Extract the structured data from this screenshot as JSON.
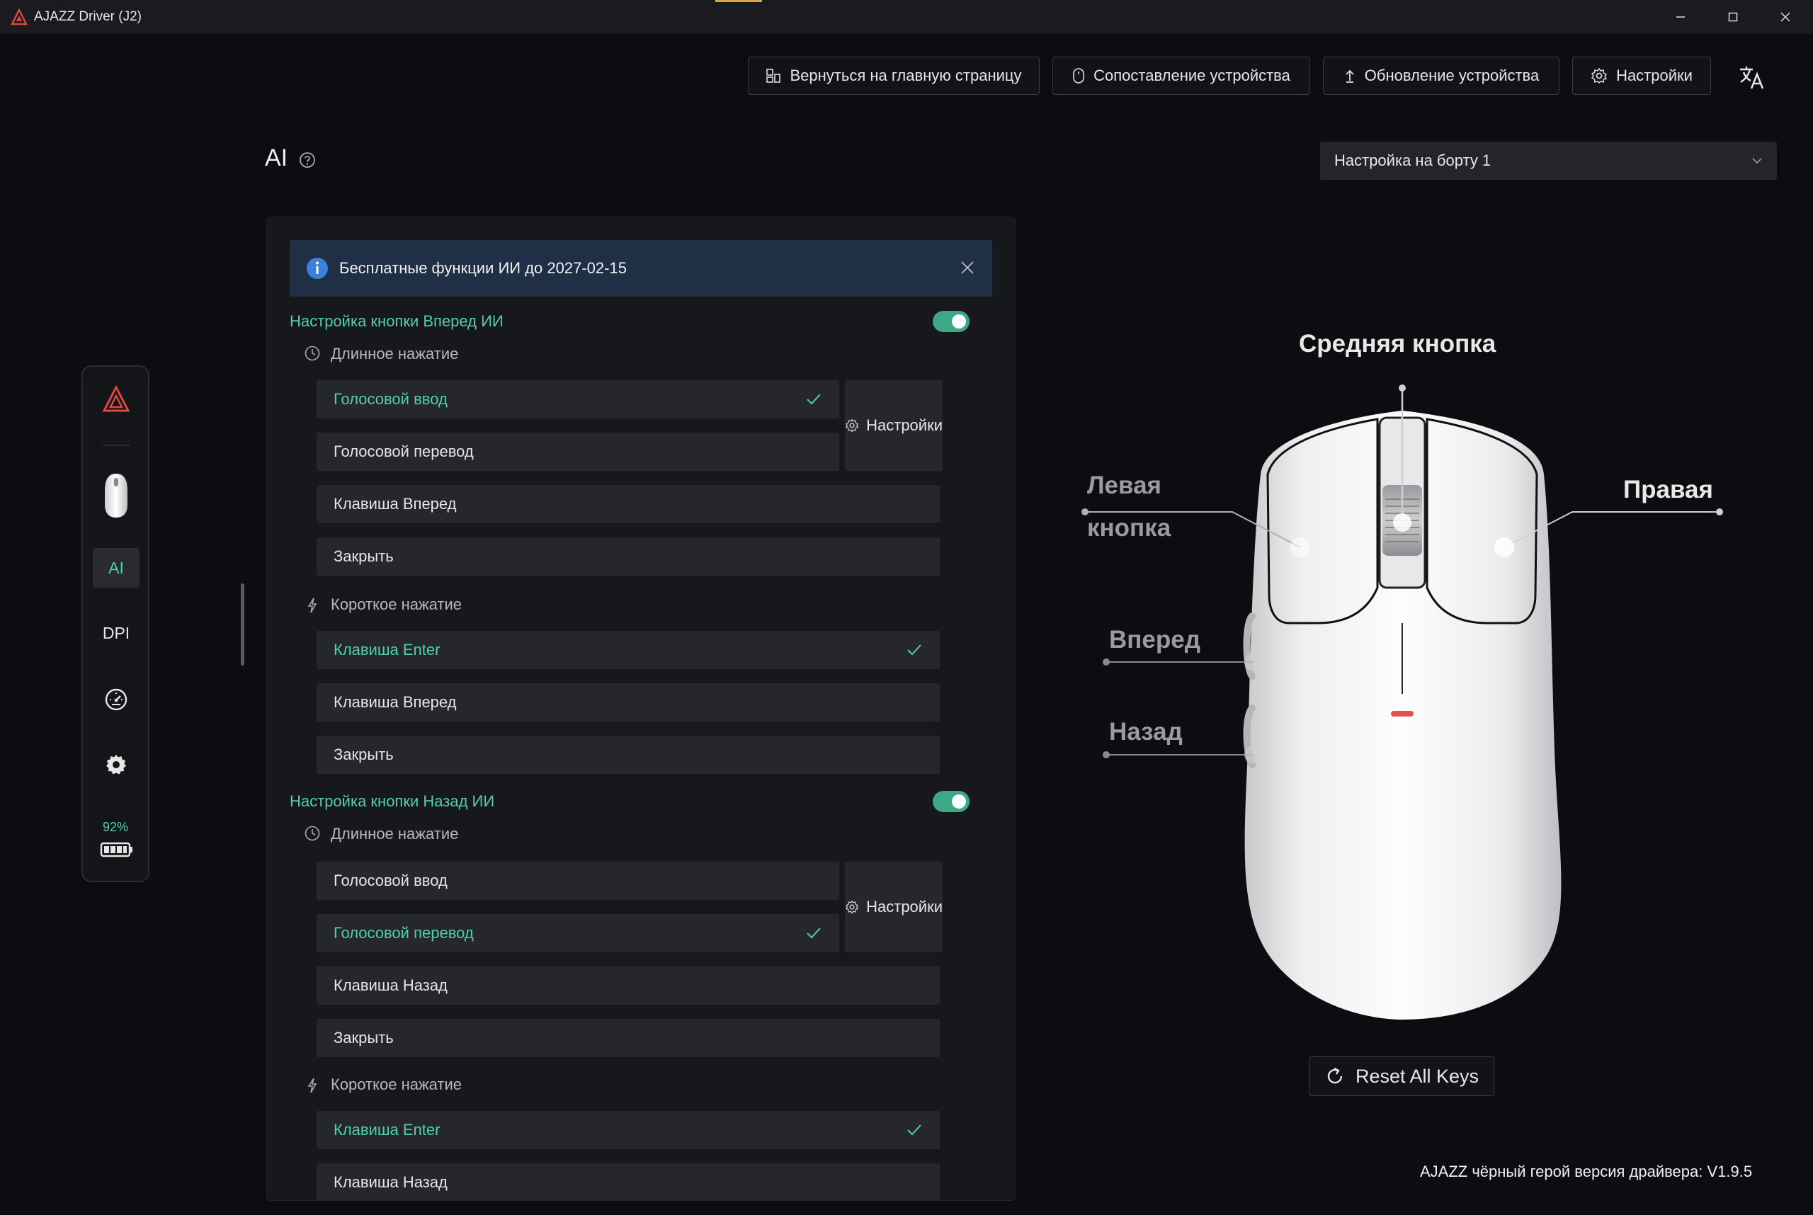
{
  "window": {
    "title": "AJAZZ Driver (J2)"
  },
  "nav": {
    "home": "Вернуться на главную страницу",
    "pairing": "Сопоставление устройства",
    "update": "Обновление устройства",
    "settings": "Настройки"
  },
  "page": {
    "title": "AI"
  },
  "profile": {
    "selected": "Настройка на борту 1"
  },
  "sidebar": {
    "items": [
      {
        "label": "AI",
        "active": true
      },
      {
        "label": "DPI"
      }
    ],
    "battery": "92%"
  },
  "banner": {
    "text": "Бесплатные функции ИИ до 2027-02-15"
  },
  "forward": {
    "title": "Настройка кнопки Вперед ИИ",
    "enabled": true,
    "long_label": "Длинное нажатие",
    "long_options": [
      "Голосовой ввод",
      "Голосовой перевод",
      "Клавиша Вперед",
      "Закрыть"
    ],
    "long_selected": "Голосовой ввод",
    "settings_label": "Настройки",
    "short_label": "Короткое нажатие",
    "short_options": [
      "Клавиша Enter",
      "Клавиша Вперед",
      "Закрыть"
    ],
    "short_selected": "Клавиша Enter"
  },
  "back": {
    "title": "Настройка кнопки Назад ИИ",
    "enabled": true,
    "long_label": "Длинное нажатие",
    "long_options": [
      "Голосовой ввод",
      "Голосовой перевод",
      "Клавиша Назад",
      "Закрыть"
    ],
    "long_selected": "Голосовой перевод",
    "settings_label": "Настройки",
    "short_label": "Короткое нажатие",
    "short_options": [
      "Клавиша Enter",
      "Клавиша Назад"
    ],
    "short_selected": "Клавиша Enter"
  },
  "mouse": {
    "middle": "Средняя кнопка",
    "left_line1": "Левая",
    "left_line2": "кнопка",
    "right": "Правая",
    "forward": "Вперед",
    "back": "Назад"
  },
  "reset": "Reset All Keys",
  "footer": {
    "version": "AJAZZ чёрный герой версия драйвера: V1.9.5"
  },
  "colors": {
    "accent": "#4fd0a5",
    "toggle": "#3ba886",
    "banner": "#1f3046",
    "brand": "#e0483d"
  }
}
